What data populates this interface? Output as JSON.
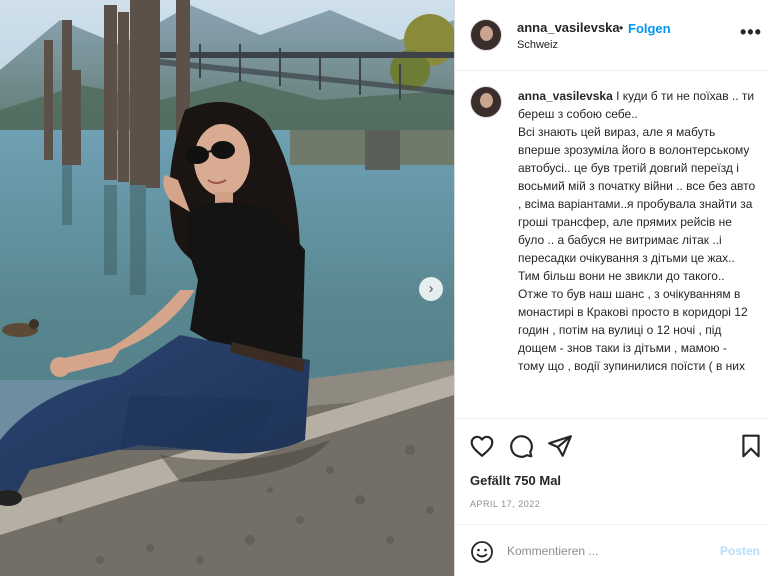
{
  "post": {
    "username": "anna_vasilevska",
    "dot": "•",
    "follow_label": "Folgen",
    "location": "Schweiz",
    "more_label": "•••"
  },
  "caption": {
    "username": "anna_vasilevska",
    "lines": [
      "І куди б ти не поїхав .. ти береш з собою себе..",
      "Всі знають цей вираз, але я мабуть вперше зрозуміла його в волонтерському автобусі.. це був третій довгий переїзд і восьмий мій з початку війни .. все без авто , всіма варіантами..я пробувала знайти за гроші трансфер, але прямих рейсів не було .. а бабуся не витримає літак ..і пересадки очікування з дітьми це жах.. Тим більш вони не звикли до такого..",
      "Отже то був наш шанс , з очікуванням в монастирі в Кракові просто в коридорі 12 годин , потім на вулиці о 12 ночі , під дощем - знов таки із дітьми , мамою - тому що , водії зупинилися поїсти ( в них"
    ]
  },
  "actions": {
    "like_icon": "heart-icon",
    "comment_icon": "comment-icon",
    "share_icon": "paper-plane-icon",
    "save_icon": "bookmark-icon"
  },
  "likes": "Gefällt 750 Mal",
  "date": "APRIL 17, 2022",
  "comment_bar": {
    "emoji_icon": "smiley-icon",
    "placeholder": "Kommentieren ...",
    "post_label": "Posten"
  },
  "carousel": {
    "next_label": "›"
  },
  "colors": {
    "accent": "#0095f6",
    "post_disabled": "#b2dffc",
    "muted": "#8e8e8e"
  }
}
